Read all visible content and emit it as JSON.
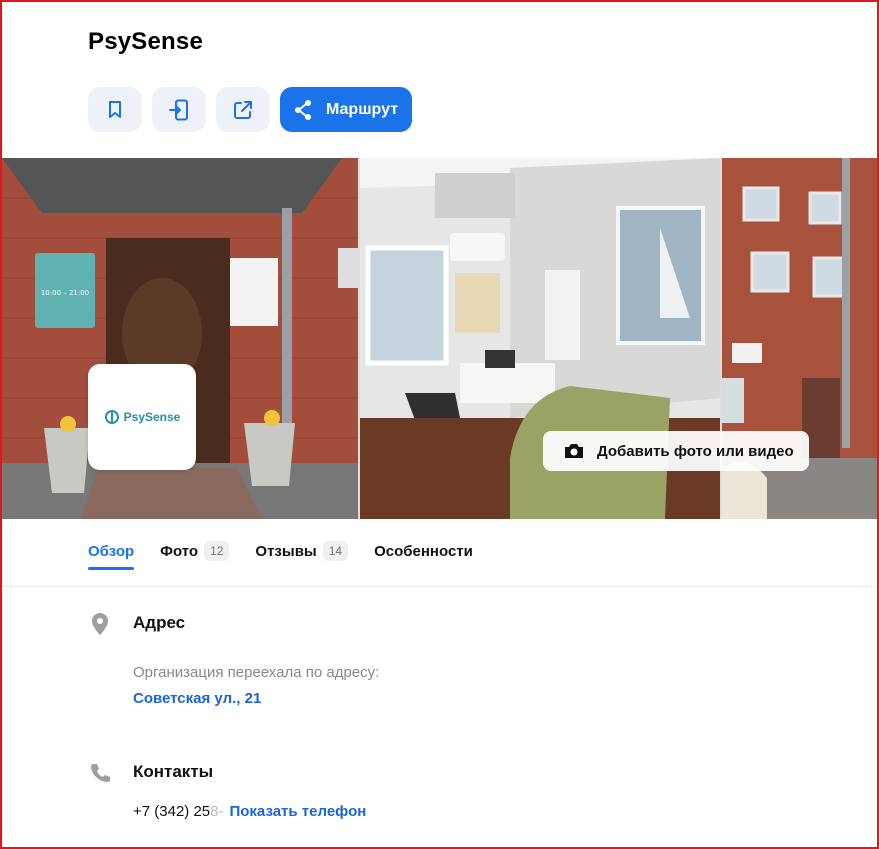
{
  "header": {
    "title": "PsySense"
  },
  "actions": {
    "bookmark_icon": "bookmark-icon",
    "send_to_phone_icon": "send-to-phone-icon",
    "share_icon": "share-icon",
    "route_label": "Маршрут"
  },
  "gallery": {
    "logo_text": "PsySense",
    "add_media_label": "Добавить фото или видео",
    "sign_hours": "10:00 – 21:00"
  },
  "tabs": [
    {
      "label": "Обзор",
      "count": "",
      "active": true
    },
    {
      "label": "Фото",
      "count": "12",
      "active": false
    },
    {
      "label": "Отзывы",
      "count": "14",
      "active": false
    },
    {
      "label": "Особенности",
      "count": "",
      "active": false
    }
  ],
  "address": {
    "heading": "Адрес",
    "moved_note": "Организация переехала по адресу:",
    "new_address": "Советская ул., 21"
  },
  "contacts": {
    "heading": "Контакты",
    "phone_visible": "+7 (342) 25",
    "phone_fade": "8-",
    "show_phone_label": "Показать телефон"
  },
  "colors": {
    "accent": "#1a73e8",
    "link": "#1a64d8",
    "frame": "#e0181e"
  }
}
